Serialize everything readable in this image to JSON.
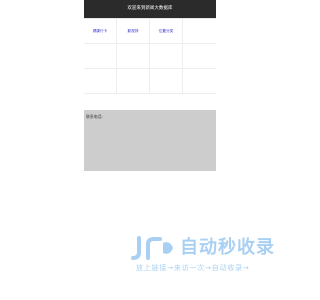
{
  "header": {
    "title": "欢迎来到新闻大数据库"
  },
  "nav": {
    "items": [
      {
        "label": "健康行卡"
      },
      {
        "label": "影视排"
      },
      {
        "label": "位置分类"
      }
    ]
  },
  "contact": {
    "label": "联系电话:"
  },
  "watermark": {
    "title": "自动秒收录",
    "tagline": "放上链接→来访一次→自动收录→",
    "icon": "jr-logo-icon",
    "color": "#2a8ce0"
  },
  "colors": {
    "header_bg": "#2b2b2b",
    "link": "#3333cc",
    "contact_bg": "#cdcdcd"
  }
}
